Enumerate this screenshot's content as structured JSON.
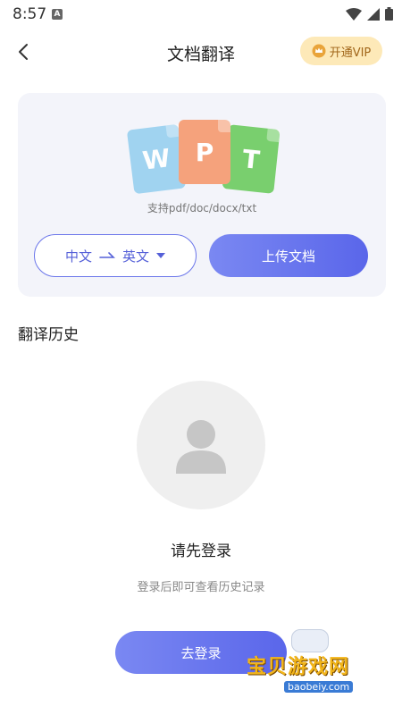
{
  "status_bar": {
    "time": "8:57",
    "a_badge": "A"
  },
  "header": {
    "title": "文档翻译",
    "vip_label": "开通VIP"
  },
  "upload_card": {
    "file_letters": [
      "W",
      "P",
      "T"
    ],
    "support_text": "支持pdf/doc/docx/txt",
    "source_lang": "中文",
    "target_lang": "英文",
    "upload_label": "上传文档"
  },
  "history": {
    "title": "翻译历史",
    "empty_title": "请先登录",
    "empty_hint": "登录后即可查看历史记录",
    "login_label": "去登录"
  },
  "watermark": {
    "brand": "宝贝游戏网",
    "url": "baobeiy.com"
  },
  "colors": {
    "accent": "#5a66ea",
    "vip_bg": "#fde9b8",
    "vip_text": "#a1661a"
  }
}
